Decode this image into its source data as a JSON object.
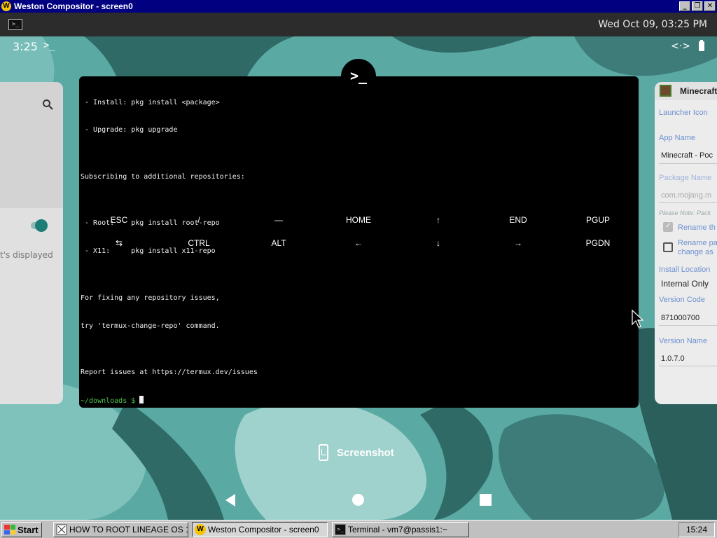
{
  "titlebar": {
    "title": "Weston Compositor - screen0",
    "minimize": "_",
    "maximize": "❐",
    "close": "✕"
  },
  "panel": {
    "clock": "Wed Oct 09, 03:25 PM"
  },
  "android_status": {
    "time": "3:25",
    "app_indicator": ">_"
  },
  "left_card": {
    "partial_text": "t's displayed"
  },
  "termux": {
    "badge": ">_",
    "lines": [
      " - Install: pkg install <package>",
      " - Upgrade: pkg upgrade",
      "",
      "Subscribing to additional repositories:",
      "",
      " - Root:    pkg install root-repo",
      " - X11:     pkg install x11-repo",
      "",
      "For fixing any repository issues,",
      "try 'termux-change-repo' command.",
      "",
      "Report issues at https://termux.dev/issues"
    ],
    "prompt": "~/downloads $ ",
    "extra_keys_row1": [
      "ESC",
      "/",
      "—",
      "HOME",
      "↑",
      "END",
      "PGUP"
    ],
    "extra_keys_row2": [
      "⇆",
      "CTRL",
      "ALT",
      "←",
      "↓",
      "→",
      "PGDN"
    ]
  },
  "right_card": {
    "app_title": "Minecraft",
    "launcher_icon_label": "Launcher Icon",
    "app_name_label": "App Name",
    "app_name_value": "Minecraft - Poc",
    "package_name_label": "Package Name",
    "package_name_value": "com.mojang.m",
    "note": "Please Note: Pack",
    "rename_label": "Rename th",
    "rename_package_label_1": "Rename pa",
    "rename_package_label_2": "change as",
    "install_location_label": "Install Location",
    "install_location_value": "Internal Only",
    "version_code_label": "Version Code",
    "version_code_value": "871000700",
    "version_name_label": "Version Name",
    "version_name_value": "1.0.7.0"
  },
  "screenshot_label": "Screenshot",
  "taskbar": {
    "start": "Start",
    "items": [
      "HOW TO ROOT LINEAGE OS 1...",
      "Weston Compositor - screen0",
      "Terminal - vm7@passis1:~"
    ],
    "clock": "15:24"
  },
  "colors": {
    "wallpaper_base": "#5aa9a3",
    "titlebar": "#000080",
    "prompt": "#4ec34e"
  }
}
